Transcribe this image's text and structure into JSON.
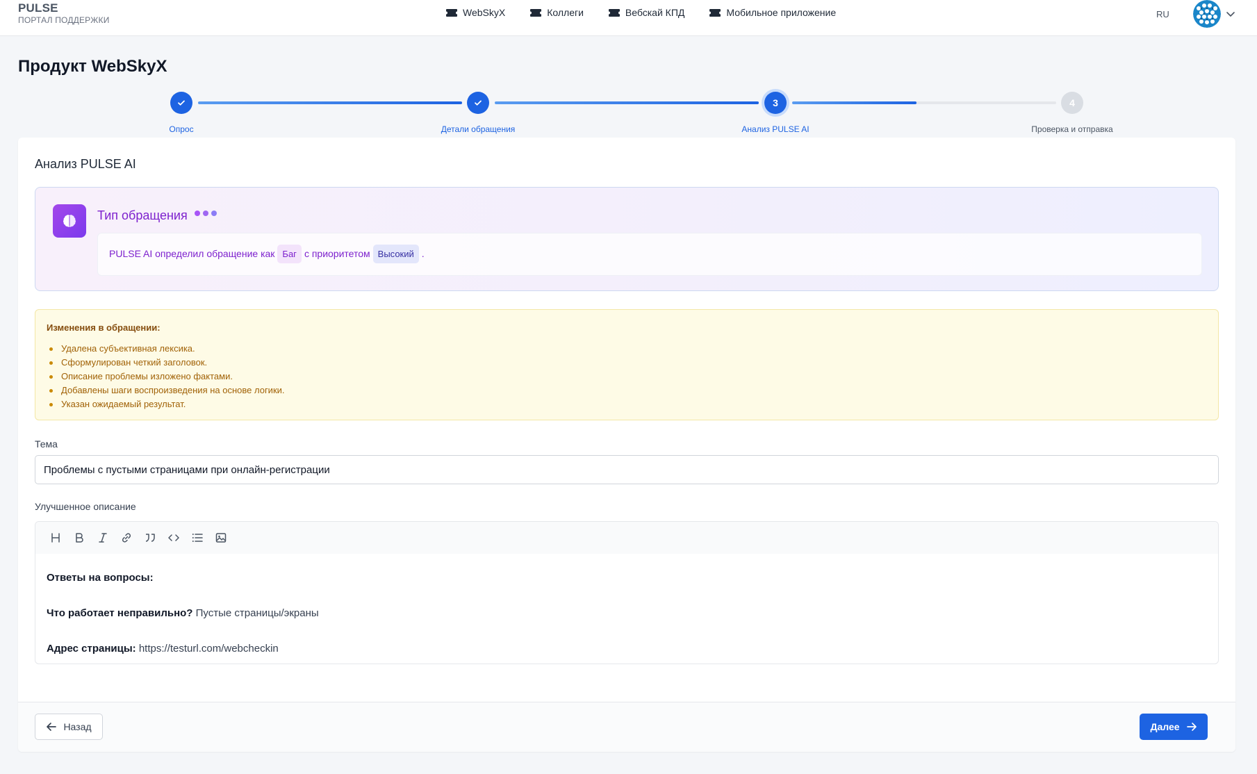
{
  "header": {
    "brand_name": "PULSE",
    "brand_subtitle": "ПОРТАЛ ПОДДЕРЖКИ",
    "nav": [
      {
        "label": "WebSkyX",
        "icon": "ticket-icon"
      },
      {
        "label": "Коллеги",
        "icon": "ticket-icon"
      },
      {
        "label": "Вебскай КПД",
        "icon": "ticket-icon"
      },
      {
        "label": "Мобильное приложение",
        "icon": "ticket-icon"
      }
    ],
    "language": "RU"
  },
  "page": {
    "title": "Продукт WebSkyX"
  },
  "stepper": {
    "steps": [
      {
        "number": "1",
        "label": "Опрос",
        "status": "done"
      },
      {
        "number": "2",
        "label": "Детали обращения",
        "status": "done"
      },
      {
        "number": "3",
        "label": "Анализ PULSE AI",
        "status": "active"
      },
      {
        "number": "4",
        "label": "Проверка и отправка",
        "status": "pending"
      }
    ],
    "progress_to_step4": 0.47
  },
  "analysis": {
    "title": "Анализ PULSE AI",
    "ai": {
      "heading": "Тип обращения",
      "text_before": "PULSE AI определил обращение как",
      "type": "Баг",
      "text_middle": "с приоритетом",
      "priority": "Высокий",
      "text_after": "."
    },
    "changes": {
      "title": "Изменения в обращении:",
      "items": [
        "Удалена субъективная лексика.",
        "Сформулирован четкий заголовок.",
        "Описание проблемы изложено фактами.",
        "Добавлены шаги воспроизведения на основе логики.",
        "Указан ожидаемый результат."
      ]
    }
  },
  "form": {
    "subject_label": "Тема",
    "subject_value": "Проблемы с пустыми страницами при онлайн-регистрации",
    "description_label": "Улучшенное описание",
    "toolbar": [
      "heading-icon",
      "bold-icon",
      "italic-icon",
      "link-icon",
      "quote-icon",
      "code-icon",
      "list-icon",
      "image-icon"
    ],
    "description": [
      {
        "bold": "Ответы на вопросы:",
        "text": ""
      },
      {
        "bold": "Что работает неправильно?",
        "text": " Пустые страницы/экраны"
      },
      {
        "bold": "Адрес страницы:",
        "text": " https://testurl.com/webcheckin"
      }
    ]
  },
  "footer": {
    "back_label": "Назад",
    "next_label": "Далее"
  },
  "colors": {
    "accent": "#1d63e2",
    "ai_purple": "#7e22ce",
    "warning_bg": "#fefbe6"
  }
}
